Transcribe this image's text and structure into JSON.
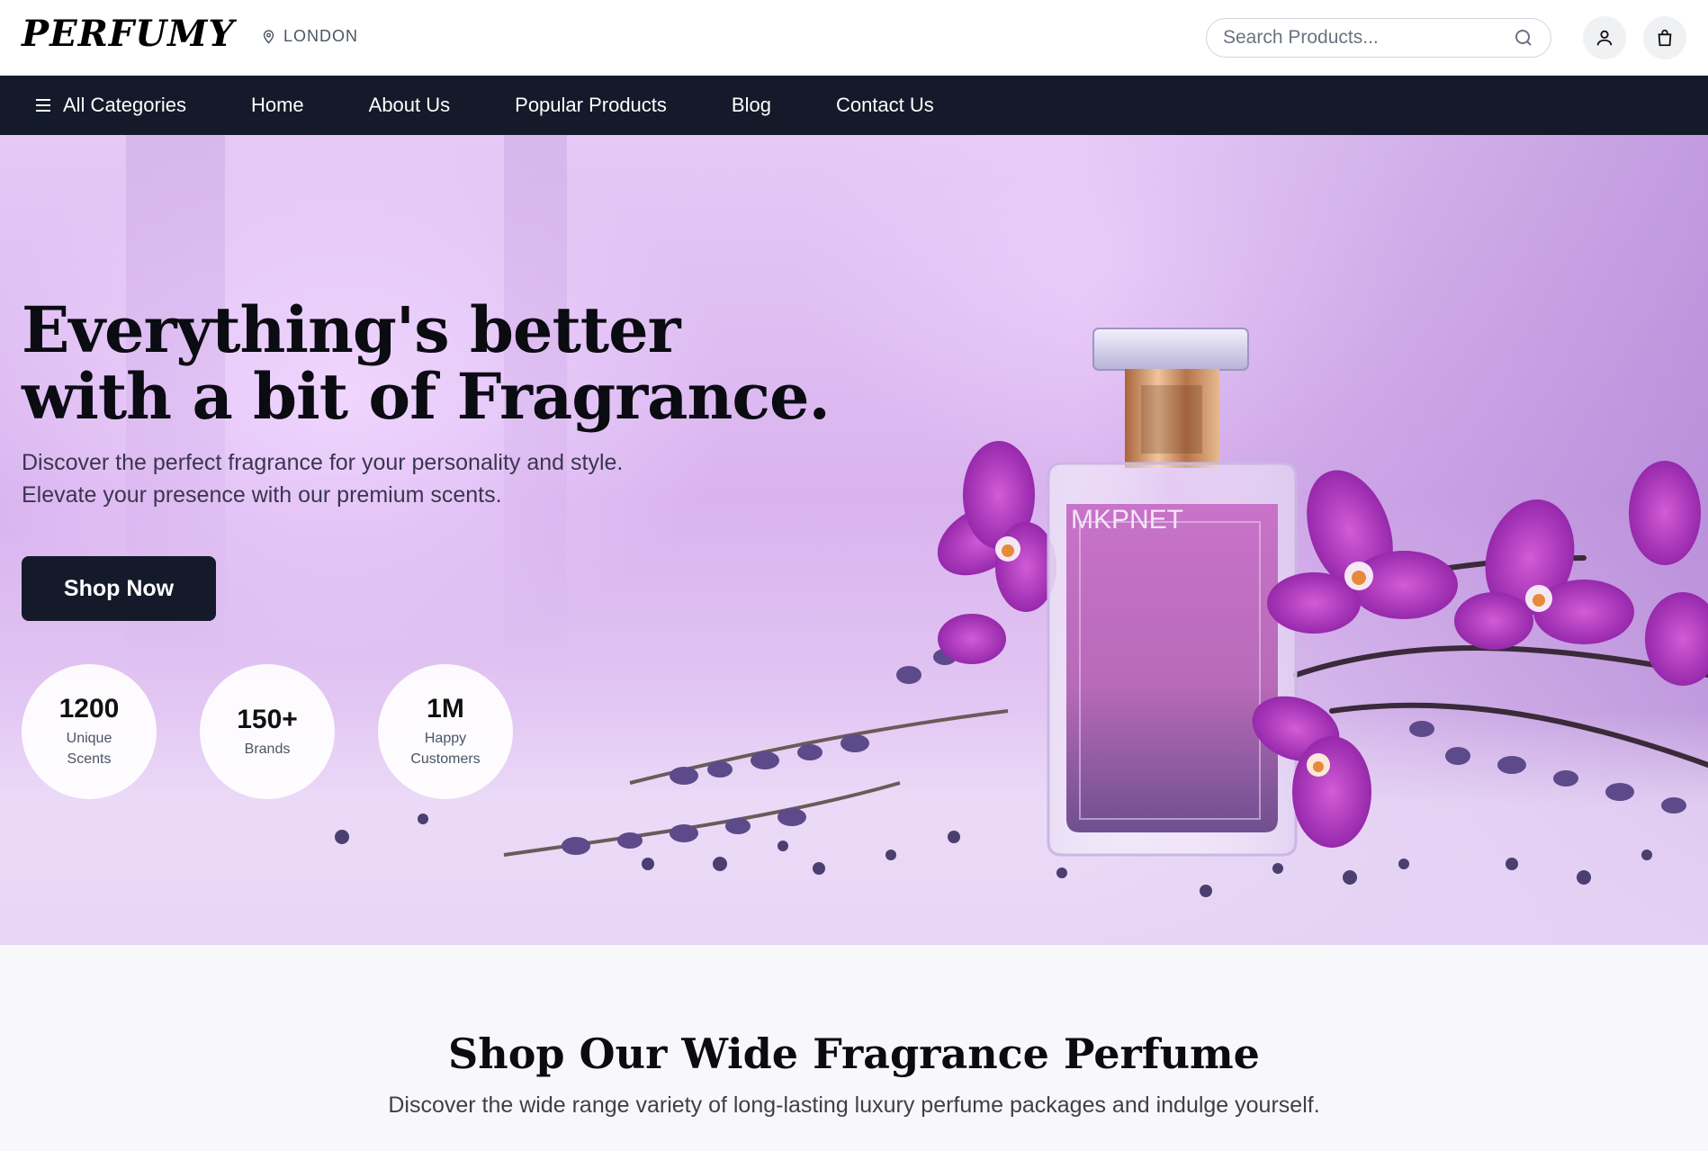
{
  "header": {
    "logo": "PERFUMY",
    "location": "LONDON",
    "search_placeholder": "Search Products..."
  },
  "nav": {
    "items": [
      "All Categories",
      "Home",
      "About Us",
      "Popular Products",
      "Blog",
      "Contact Us"
    ]
  },
  "hero": {
    "title": "Everything's better with a bit of Fragrance.",
    "subtitle": "Discover the perfect fragrance for your personality and style. Elevate your presence with our premium scents.",
    "cta_label": "Shop Now",
    "bottle_label": "MKPNET",
    "stats": [
      {
        "value": "1200",
        "label": "Unique Scents"
      },
      {
        "value": "150+",
        "label": "Brands"
      },
      {
        "value": "1M",
        "label": "Happy Customers"
      }
    ]
  },
  "section": {
    "title": "Shop Our Wide Fragrance Perfume",
    "subtitle": "Discover the wide range variety of long-lasting luxury perfume packages and indulge yourself."
  },
  "colors": {
    "nav_bg": "#141a2a",
    "hero_bg": "#dcb8f0",
    "accent_purple": "#9b2fb5"
  },
  "icons": {
    "location": "map-pin-icon",
    "search": "search-icon",
    "user": "user-icon",
    "cart": "shopping-bag-icon",
    "menu": "hamburger-menu-icon"
  }
}
